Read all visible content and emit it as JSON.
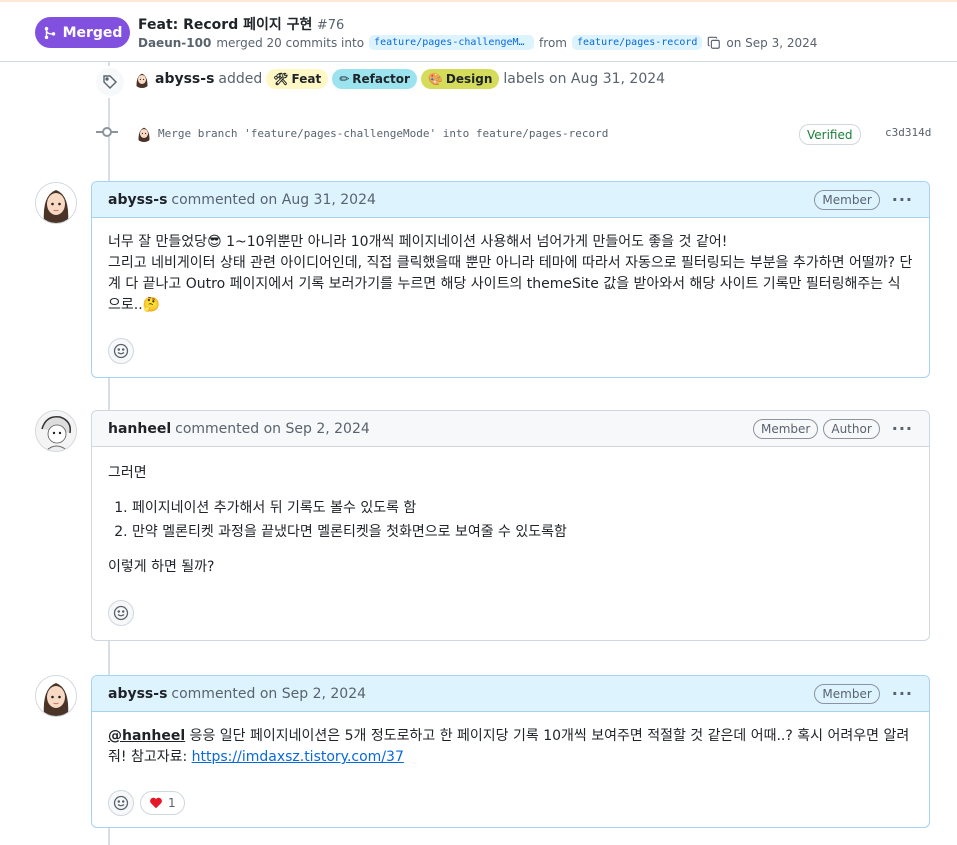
{
  "header": {
    "state_label": "Merged",
    "title": "Feat: Record 페이지 구현",
    "number": "#76",
    "user": "Daeun-100",
    "merged_text": "merged 20 commits into",
    "base_branch": "feature/pages-challengeMo…",
    "from_text": "from",
    "head_branch": "feature/pages-record",
    "date_text": "on Sep 3, 2024"
  },
  "label_event": {
    "user": "abyss-s",
    "action": "added",
    "labels": [
      {
        "name": "Feat",
        "color": "#fff8c5",
        "icon": "gear-emoji"
      },
      {
        "name": "Refactor",
        "color": "#9be4ef",
        "icon": "pencil-emoji"
      },
      {
        "name": "Design",
        "color": "#d4dc5a",
        "icon": "palette-emoji"
      }
    ],
    "suffix": "labels on Aug 31, 2024"
  },
  "commit_event": {
    "message": "Merge branch 'feature/pages-challengeMode' into feature/pages-record",
    "verified": "Verified",
    "sha": "c3d314d"
  },
  "comments": [
    {
      "author": "abyss-s",
      "meta": "commented on Aug 31, 2024",
      "badges": [
        "Member"
      ],
      "body_p1": "너무 잘 만들었당",
      "body_p1b": " 1~10위뿐만 아니라 10개씩 페이지네이션 사용해서 넘어가게 만들어도 좋을 것 같어!",
      "body_p2": "그리고 네비게이터 상태 관련 아이디어인데, 직접 클릭했을때 뿐만 아니라 테마에 따라서 자동으로 필터링되는 부분을 추가하면 어떨까? 단계 다 끝나고 Outro 페이지에서 기록 보러가기를 누르면 해당 사이트의 themeSite 값을 받아와서 해당 사이트 기록만 필터링해주는 식으로.."
    },
    {
      "author": "hanheel",
      "meta": "commented on Sep 2, 2024",
      "badges": [
        "Member",
        "Author"
      ],
      "intro": "그러면",
      "items": [
        "페이지네이션 추가해서 뒤 기록도 볼수 있도록 함",
        "만약 멜론티켓 과정을 끝냈다면 멜론티켓을 첫화면으로 보여줄 수 있도록함"
      ],
      "outro": "이렇게 하면 될까?"
    },
    {
      "author": "abyss-s",
      "meta": "commented on Sep 2, 2024",
      "badges": [
        "Member"
      ],
      "mention": "@hanheel",
      "body": " 응응 일단 페이지네이션은 5개 정도로하고 한 페이지당 기록 10개씩 보여주면 적절할 것 같은데 어때..? 혹시 어려우면 알려줘! 참고자료: ",
      "link": "https://imdaxsz.tistory.com/37",
      "reaction_count": "1"
    }
  ]
}
